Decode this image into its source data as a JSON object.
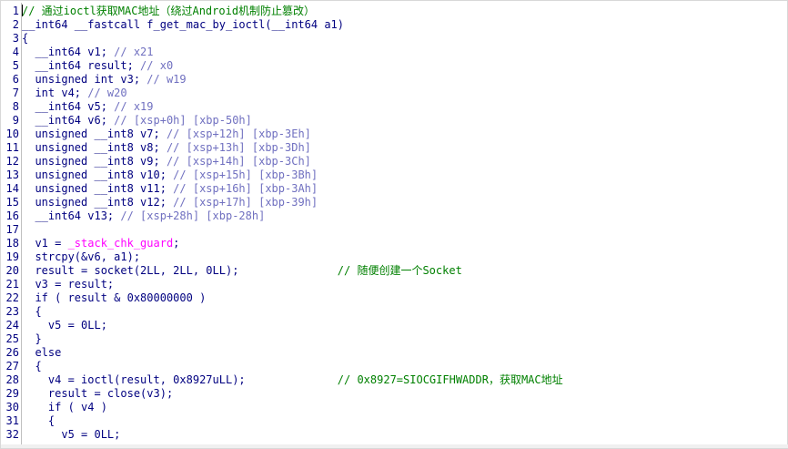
{
  "editor": {
    "lines": [
      {
        "num": "1",
        "parts": [
          {
            "t": "// 通过ioctl获取MAC地址（绕过Android机制防止篡改）",
            "c": "cm"
          }
        ]
      },
      {
        "num": "2",
        "parts": [
          {
            "t": "__int64 __fastcall f_get_mac_by_ioctl(__int64 a1)",
            "c": "kw"
          }
        ]
      },
      {
        "num": "3",
        "parts": [
          {
            "t": "{",
            "c": "kw"
          }
        ]
      },
      {
        "num": "4",
        "parts": [
          {
            "t": "  __int64 v1; ",
            "c": "kw"
          },
          {
            "t": "// x21",
            "c": "reg"
          }
        ]
      },
      {
        "num": "5",
        "parts": [
          {
            "t": "  __int64 result; ",
            "c": "kw"
          },
          {
            "t": "// x0",
            "c": "reg"
          }
        ]
      },
      {
        "num": "6",
        "parts": [
          {
            "t": "  unsigned int v3; ",
            "c": "kw"
          },
          {
            "t": "// w19",
            "c": "reg"
          }
        ]
      },
      {
        "num": "7",
        "parts": [
          {
            "t": "  int v4; ",
            "c": "kw"
          },
          {
            "t": "// w20",
            "c": "reg"
          }
        ]
      },
      {
        "num": "8",
        "parts": [
          {
            "t": "  __int64 v5; ",
            "c": "kw"
          },
          {
            "t": "// x19",
            "c": "reg"
          }
        ]
      },
      {
        "num": "9",
        "parts": [
          {
            "t": "  __int64 v6; ",
            "c": "kw"
          },
          {
            "t": "// [xsp+0h] [xbp-50h]",
            "c": "reg"
          }
        ]
      },
      {
        "num": "10",
        "parts": [
          {
            "t": "  unsigned __int8 v7; ",
            "c": "kw"
          },
          {
            "t": "// [xsp+12h] [xbp-3Eh]",
            "c": "reg"
          }
        ]
      },
      {
        "num": "11",
        "parts": [
          {
            "t": "  unsigned __int8 v8; ",
            "c": "kw"
          },
          {
            "t": "// [xsp+13h] [xbp-3Dh]",
            "c": "reg"
          }
        ]
      },
      {
        "num": "12",
        "parts": [
          {
            "t": "  unsigned __int8 v9; ",
            "c": "kw"
          },
          {
            "t": "// [xsp+14h] [xbp-3Ch]",
            "c": "reg"
          }
        ]
      },
      {
        "num": "13",
        "parts": [
          {
            "t": "  unsigned __int8 v10; ",
            "c": "kw"
          },
          {
            "t": "// [xsp+15h] [xbp-3Bh]",
            "c": "reg"
          }
        ]
      },
      {
        "num": "14",
        "parts": [
          {
            "t": "  unsigned __int8 v11; ",
            "c": "kw"
          },
          {
            "t": "// [xsp+16h] [xbp-3Ah]",
            "c": "reg"
          }
        ]
      },
      {
        "num": "15",
        "parts": [
          {
            "t": "  unsigned __int8 v12; ",
            "c": "kw"
          },
          {
            "t": "// [xsp+17h] [xbp-39h]",
            "c": "reg"
          }
        ]
      },
      {
        "num": "16",
        "parts": [
          {
            "t": "  __int64 v13; ",
            "c": "kw"
          },
          {
            "t": "// [xsp+28h] [xbp-28h]",
            "c": "reg"
          }
        ]
      },
      {
        "num": "17",
        "parts": [
          {
            "t": "",
            "c": "kw"
          }
        ]
      },
      {
        "num": "18",
        "parts": [
          {
            "t": "  v1 = ",
            "c": "kw"
          },
          {
            "t": "_stack_chk_guard",
            "c": "gl"
          },
          {
            "t": ";",
            "c": "kw"
          }
        ]
      },
      {
        "num": "19",
        "parts": [
          {
            "t": "  strcpy(&v6, a1);",
            "c": "kw"
          }
        ]
      },
      {
        "num": "20",
        "parts": [
          {
            "t": "  result = socket(2LL, 2LL, 0LL);               ",
            "c": "kw"
          },
          {
            "t": "// 随便创建一个Socket",
            "c": "cm"
          }
        ]
      },
      {
        "num": "21",
        "parts": [
          {
            "t": "  v3 = result;",
            "c": "kw"
          }
        ]
      },
      {
        "num": "22",
        "parts": [
          {
            "t": "  if ( result & 0x80000000 )",
            "c": "kw"
          }
        ]
      },
      {
        "num": "23",
        "parts": [
          {
            "t": "  {",
            "c": "kw"
          }
        ]
      },
      {
        "num": "24",
        "parts": [
          {
            "t": "    v5 = 0LL;",
            "c": "kw"
          }
        ]
      },
      {
        "num": "25",
        "parts": [
          {
            "t": "  }",
            "c": "kw"
          }
        ]
      },
      {
        "num": "26",
        "parts": [
          {
            "t": "  else",
            "c": "kw"
          }
        ]
      },
      {
        "num": "27",
        "parts": [
          {
            "t": "  {",
            "c": "kw"
          }
        ]
      },
      {
        "num": "28",
        "parts": [
          {
            "t": "    v4 = ioctl(result, 0x8927uLL);              ",
            "c": "kw"
          },
          {
            "t": "// 0x8927=SIOCGIFHWADDR，获取MAC地址",
            "c": "cm"
          }
        ]
      },
      {
        "num": "29",
        "parts": [
          {
            "t": "    result = close(v3);",
            "c": "kw"
          }
        ]
      },
      {
        "num": "30",
        "parts": [
          {
            "t": "    if ( v4 )",
            "c": "kw"
          }
        ]
      },
      {
        "num": "31",
        "parts": [
          {
            "t": "    {",
            "c": "kw"
          }
        ]
      },
      {
        "num": "32",
        "parts": [
          {
            "t": "      v5 = 0LL;",
            "c": "kw"
          }
        ]
      }
    ]
  },
  "colors": {
    "keyword": "#000080",
    "comment": "#008000",
    "register_comment": "#7070c0",
    "global": "#ff00ff",
    "background": "#ffffff"
  }
}
